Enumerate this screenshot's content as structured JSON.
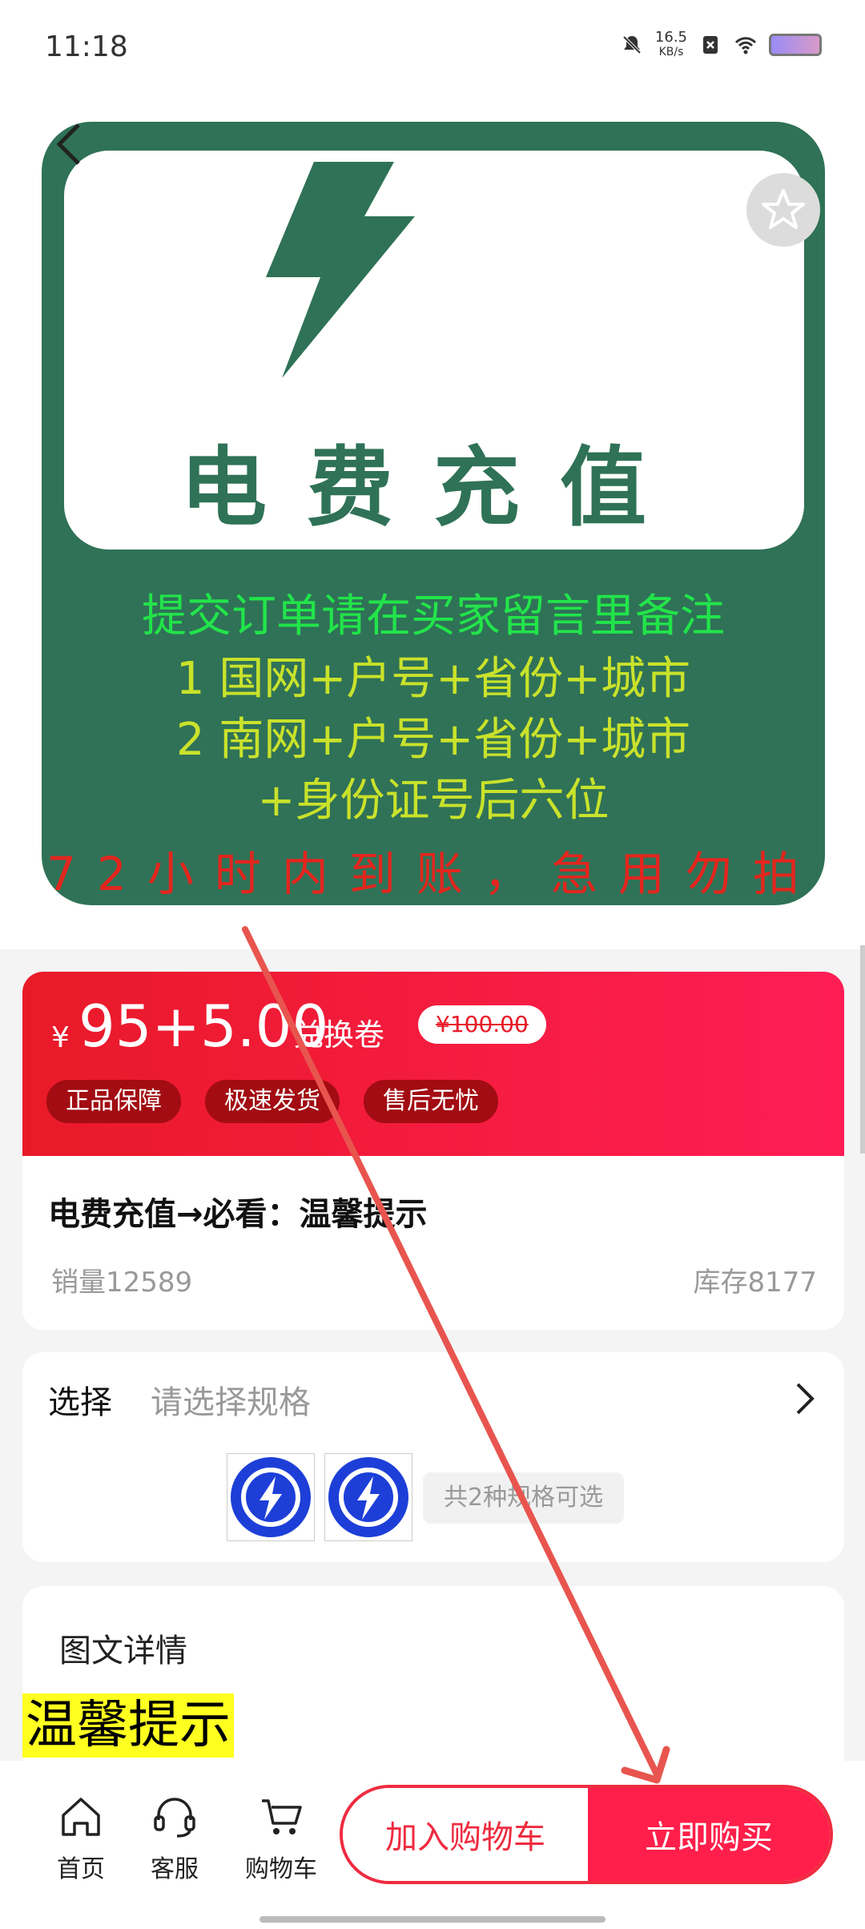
{
  "status_bar": {
    "time": "11:18",
    "net_speed": "16.5",
    "net_unit": "KB/s"
  },
  "poster": {
    "title": "电费充值",
    "line1": "提交订单请在买家留言里备注",
    "line2": "1 国网+户号+省份+城市",
    "line3": "2 南网+户号+省份+城市",
    "line4": "+身份证号后六位",
    "line5": "72小时内到账，急用勿拍"
  },
  "price": {
    "currency": "¥",
    "value": "95+5.00",
    "suffix": "兑换卷",
    "original": "¥100.00"
  },
  "tags": [
    "正品保障",
    "极速发货",
    "售后无忧"
  ],
  "product": {
    "title": "电费充值→必看：温馨提示",
    "sales": "销量12589",
    "stock": "库存8177"
  },
  "spec": {
    "label": "选择",
    "placeholder": "请选择规格",
    "count": "共2种规格可选"
  },
  "details": {
    "heading": "图文详情",
    "tips": "温馨提示"
  },
  "bottom_nav": {
    "home": "首页",
    "service": "客服",
    "cart": "购物车",
    "add_cart": "加入购物车",
    "buy_now": "立即购买"
  },
  "colors": {
    "poster_green": "#2f7257",
    "accent_red": "#ef2b3f",
    "annotation_arrow": "#e8554e"
  }
}
